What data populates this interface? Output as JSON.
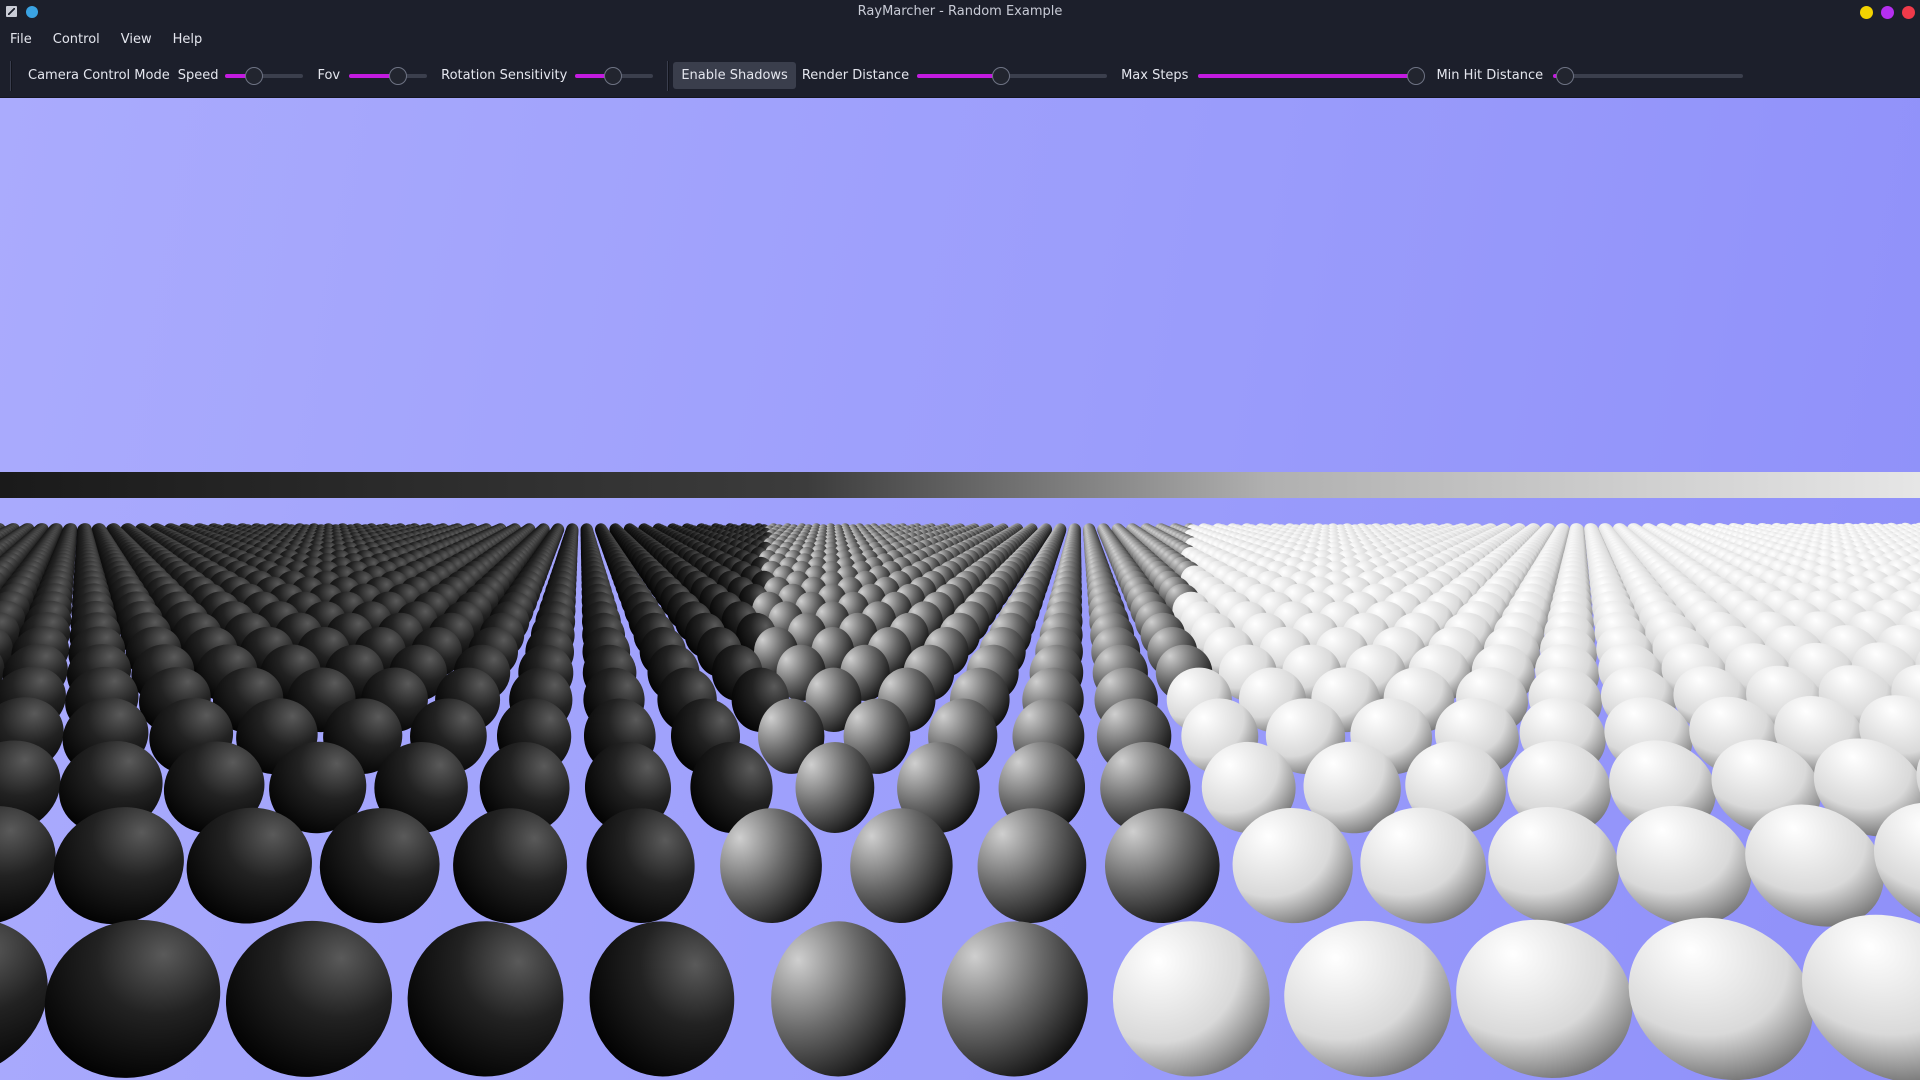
{
  "window": {
    "title": "RayMarcher - Random Example"
  },
  "menu": {
    "items": [
      {
        "label": "File"
      },
      {
        "label": "Control"
      },
      {
        "label": "View"
      },
      {
        "label": "Help"
      }
    ]
  },
  "toolbar": {
    "camera_mode_label": "Camera Control Mode",
    "speed": {
      "label": "Speed",
      "value": 0.36
    },
    "fov": {
      "label": "Fov",
      "value": 0.63
    },
    "rotation_sensitivity": {
      "label": "Rotation Sensitivity",
      "value": 0.48
    },
    "enable_shadows_label": "Enable Shadows",
    "render_distance": {
      "label": "Render Distance",
      "value": 0.44
    },
    "max_steps": {
      "label": "Max Steps",
      "value": 1.0
    },
    "min_hit_distance": {
      "label": "Min Hit Distance",
      "value": 0.06
    }
  },
  "colors": {
    "accent": "#c31be0",
    "sky_light": "#aaabfd",
    "sky_dark": "#8f90f9"
  },
  "icons": {
    "app": "app-icon",
    "minimize": "minimize-dot",
    "maximize": "maximize-dot",
    "close": "close-dot"
  }
}
